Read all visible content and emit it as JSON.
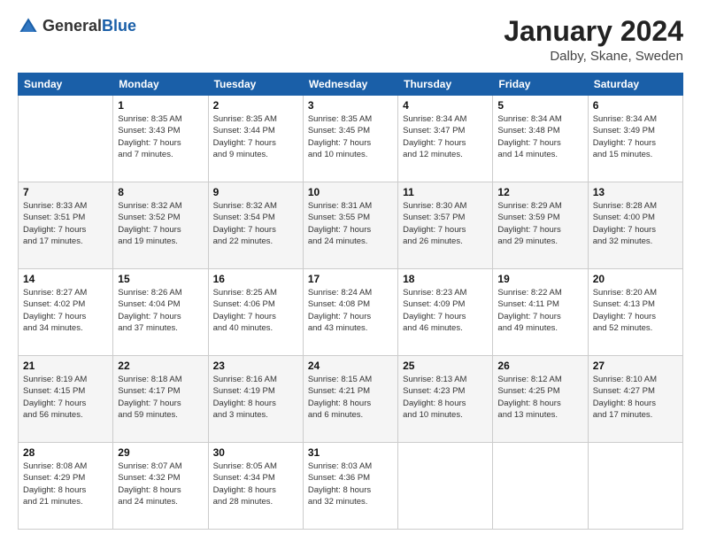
{
  "header": {
    "logo": {
      "text_general": "General",
      "text_blue": "Blue"
    },
    "title": "January 2024",
    "location": "Dalby, Skane, Sweden"
  },
  "weekdays": [
    "Sunday",
    "Monday",
    "Tuesday",
    "Wednesday",
    "Thursday",
    "Friday",
    "Saturday"
  ],
  "weeks": [
    [
      {
        "day": "",
        "info": ""
      },
      {
        "day": "1",
        "info": "Sunrise: 8:35 AM\nSunset: 3:43 PM\nDaylight: 7 hours\nand 7 minutes."
      },
      {
        "day": "2",
        "info": "Sunrise: 8:35 AM\nSunset: 3:44 PM\nDaylight: 7 hours\nand 9 minutes."
      },
      {
        "day": "3",
        "info": "Sunrise: 8:35 AM\nSunset: 3:45 PM\nDaylight: 7 hours\nand 10 minutes."
      },
      {
        "day": "4",
        "info": "Sunrise: 8:34 AM\nSunset: 3:47 PM\nDaylight: 7 hours\nand 12 minutes."
      },
      {
        "day": "5",
        "info": "Sunrise: 8:34 AM\nSunset: 3:48 PM\nDaylight: 7 hours\nand 14 minutes."
      },
      {
        "day": "6",
        "info": "Sunrise: 8:34 AM\nSunset: 3:49 PM\nDaylight: 7 hours\nand 15 minutes."
      }
    ],
    [
      {
        "day": "7",
        "info": "Sunrise: 8:33 AM\nSunset: 3:51 PM\nDaylight: 7 hours\nand 17 minutes."
      },
      {
        "day": "8",
        "info": "Sunrise: 8:32 AM\nSunset: 3:52 PM\nDaylight: 7 hours\nand 19 minutes."
      },
      {
        "day": "9",
        "info": "Sunrise: 8:32 AM\nSunset: 3:54 PM\nDaylight: 7 hours\nand 22 minutes."
      },
      {
        "day": "10",
        "info": "Sunrise: 8:31 AM\nSunset: 3:55 PM\nDaylight: 7 hours\nand 24 minutes."
      },
      {
        "day": "11",
        "info": "Sunrise: 8:30 AM\nSunset: 3:57 PM\nDaylight: 7 hours\nand 26 minutes."
      },
      {
        "day": "12",
        "info": "Sunrise: 8:29 AM\nSunset: 3:59 PM\nDaylight: 7 hours\nand 29 minutes."
      },
      {
        "day": "13",
        "info": "Sunrise: 8:28 AM\nSunset: 4:00 PM\nDaylight: 7 hours\nand 32 minutes."
      }
    ],
    [
      {
        "day": "14",
        "info": "Sunrise: 8:27 AM\nSunset: 4:02 PM\nDaylight: 7 hours\nand 34 minutes."
      },
      {
        "day": "15",
        "info": "Sunrise: 8:26 AM\nSunset: 4:04 PM\nDaylight: 7 hours\nand 37 minutes."
      },
      {
        "day": "16",
        "info": "Sunrise: 8:25 AM\nSunset: 4:06 PM\nDaylight: 7 hours\nand 40 minutes."
      },
      {
        "day": "17",
        "info": "Sunrise: 8:24 AM\nSunset: 4:08 PM\nDaylight: 7 hours\nand 43 minutes."
      },
      {
        "day": "18",
        "info": "Sunrise: 8:23 AM\nSunset: 4:09 PM\nDaylight: 7 hours\nand 46 minutes."
      },
      {
        "day": "19",
        "info": "Sunrise: 8:22 AM\nSunset: 4:11 PM\nDaylight: 7 hours\nand 49 minutes."
      },
      {
        "day": "20",
        "info": "Sunrise: 8:20 AM\nSunset: 4:13 PM\nDaylight: 7 hours\nand 52 minutes."
      }
    ],
    [
      {
        "day": "21",
        "info": "Sunrise: 8:19 AM\nSunset: 4:15 PM\nDaylight: 7 hours\nand 56 minutes."
      },
      {
        "day": "22",
        "info": "Sunrise: 8:18 AM\nSunset: 4:17 PM\nDaylight: 7 hours\nand 59 minutes."
      },
      {
        "day": "23",
        "info": "Sunrise: 8:16 AM\nSunset: 4:19 PM\nDaylight: 8 hours\nand 3 minutes."
      },
      {
        "day": "24",
        "info": "Sunrise: 8:15 AM\nSunset: 4:21 PM\nDaylight: 8 hours\nand 6 minutes."
      },
      {
        "day": "25",
        "info": "Sunrise: 8:13 AM\nSunset: 4:23 PM\nDaylight: 8 hours\nand 10 minutes."
      },
      {
        "day": "26",
        "info": "Sunrise: 8:12 AM\nSunset: 4:25 PM\nDaylight: 8 hours\nand 13 minutes."
      },
      {
        "day": "27",
        "info": "Sunrise: 8:10 AM\nSunset: 4:27 PM\nDaylight: 8 hours\nand 17 minutes."
      }
    ],
    [
      {
        "day": "28",
        "info": "Sunrise: 8:08 AM\nSunset: 4:29 PM\nDaylight: 8 hours\nand 21 minutes."
      },
      {
        "day": "29",
        "info": "Sunrise: 8:07 AM\nSunset: 4:32 PM\nDaylight: 8 hours\nand 24 minutes."
      },
      {
        "day": "30",
        "info": "Sunrise: 8:05 AM\nSunset: 4:34 PM\nDaylight: 8 hours\nand 28 minutes."
      },
      {
        "day": "31",
        "info": "Sunrise: 8:03 AM\nSunset: 4:36 PM\nDaylight: 8 hours\nand 32 minutes."
      },
      {
        "day": "",
        "info": ""
      },
      {
        "day": "",
        "info": ""
      },
      {
        "day": "",
        "info": ""
      }
    ]
  ]
}
